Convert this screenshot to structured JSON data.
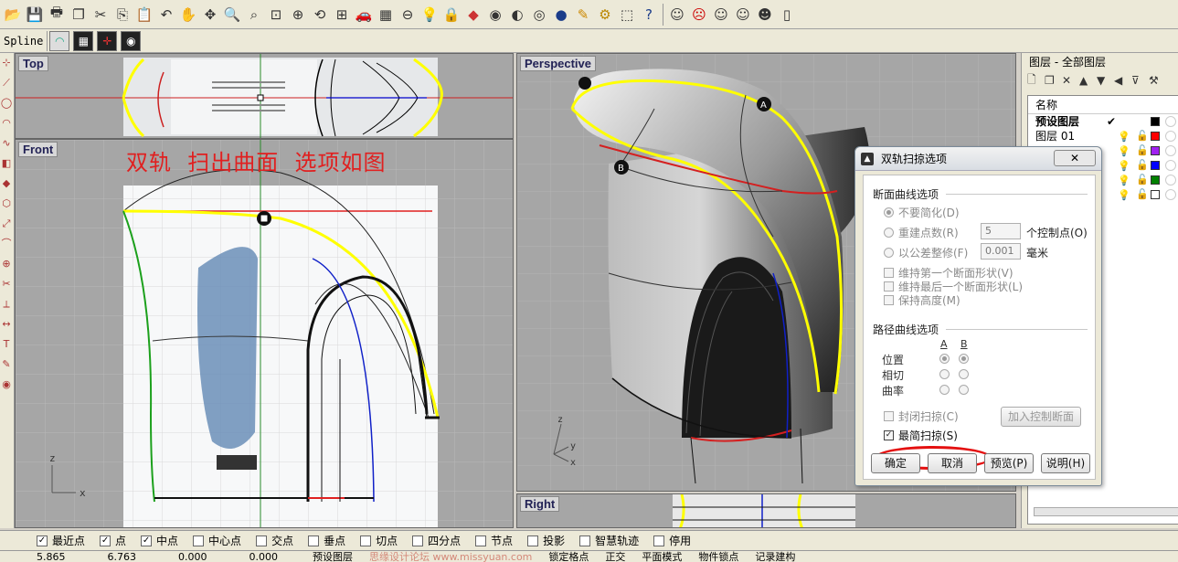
{
  "toolbar": {
    "icons": [
      "folder-open-icon",
      "save-icon",
      "print-icon",
      "copy-file-icon",
      "cut-icon",
      "copy-icon",
      "paste-icon",
      "undo-icon",
      "pan-icon",
      "move-view-icon",
      "zoom-icon",
      "zoom-window-icon",
      "zoom-extents-icon",
      "zoom-selected-icon",
      "rotate-view-icon",
      "four-viewports-icon",
      "car-icon",
      "grid-icon",
      "snap-icon",
      "light-icon",
      "lock-icon",
      "render-icon",
      "color-wheel-icon",
      "shaded-icon",
      "wireframe-sphere-icon",
      "render-sphere-icon",
      "pen-icon",
      "gears-icon",
      "select-icon",
      "help-icon",
      "face-1-icon",
      "face-2-icon",
      "face-3-icon",
      "face-4-icon",
      "face-5-icon",
      "face-6-icon"
    ]
  },
  "toolbar2": {
    "spline_label": "Spline"
  },
  "viewports": {
    "top": {
      "label": "Top"
    },
    "front": {
      "label": "Front"
    },
    "perspective": {
      "label": "Perspective"
    },
    "right": {
      "label": "Right"
    },
    "axis_x": "x",
    "axis_y": "y",
    "axis_z": "z"
  },
  "annotation": "双轨  扫出曲面  选项如图",
  "point_labels": {
    "a": "A",
    "b": "B"
  },
  "layers_panel": {
    "title": "图层 - 全部图层",
    "column_name": "名称",
    "rows": [
      {
        "name": "预设图层",
        "color": "#000000",
        "bold": true,
        "current": true
      },
      {
        "name": "图层 01",
        "color": "#ff0000"
      },
      {
        "name": "",
        "color": "#a020f0"
      },
      {
        "name": "",
        "color": "#0000ff"
      },
      {
        "name": "",
        "color": "#008000"
      },
      {
        "name": "",
        "color": "#ffffff"
      }
    ],
    "current_mark": "✔"
  },
  "dialog": {
    "title": "双轨扫掠选项",
    "close_label": "✕",
    "section_shape": "断面曲线选项",
    "opt_no_simplify": "不要简化(D)",
    "opt_rebuild": "重建点数(R)",
    "rebuild_value": "5",
    "rebuild_unit": "个控制点(O)",
    "opt_refit": "以公差整修(F)",
    "refit_value": "0.001",
    "refit_unit": "毫米",
    "chk_keep_first": "维持第一个断面形状(V)",
    "chk_keep_last": "维持最后一个断面形状(L)",
    "chk_keep_height": "保持高度(M)",
    "section_rail": "路径曲线选项",
    "col_a": "A",
    "col_b": "B",
    "row_position": "位置",
    "row_tangent": "相切",
    "row_curvature": "曲率",
    "chk_closed": "封闭扫掠(C)",
    "btn_add_slash": "加入控制断面",
    "chk_simple": "最简扫掠(S)",
    "btn_ok": "确定",
    "btn_cancel": "取消",
    "btn_preview": "预览(P)",
    "btn_help": "说明(H)"
  },
  "osnap": {
    "items": [
      {
        "label": "最近点",
        "checked": true
      },
      {
        "label": "点",
        "checked": true
      },
      {
        "label": "中点",
        "checked": true
      },
      {
        "label": "中心点",
        "checked": false
      },
      {
        "label": "交点",
        "checked": false
      },
      {
        "label": "垂点",
        "checked": false
      },
      {
        "label": "切点",
        "checked": false
      },
      {
        "label": "四分点",
        "checked": false
      },
      {
        "label": "节点",
        "checked": false
      },
      {
        "label": "投影",
        "checked": false
      },
      {
        "label": "智慧轨迹",
        "checked": false
      },
      {
        "label": "停用",
        "checked": false
      }
    ]
  },
  "statusbar": {
    "x": "5.865",
    "y": "6.763",
    "z": "0.000",
    "d": "0.000",
    "layer": "预设图层",
    "grid_snap": "锁定格点",
    "ortho": "正交",
    "planar": "平面模式",
    "osnap": "物件锁点",
    "record": "记录建构",
    "watermark": "思缘设计论坛 www.missyuan.com"
  }
}
